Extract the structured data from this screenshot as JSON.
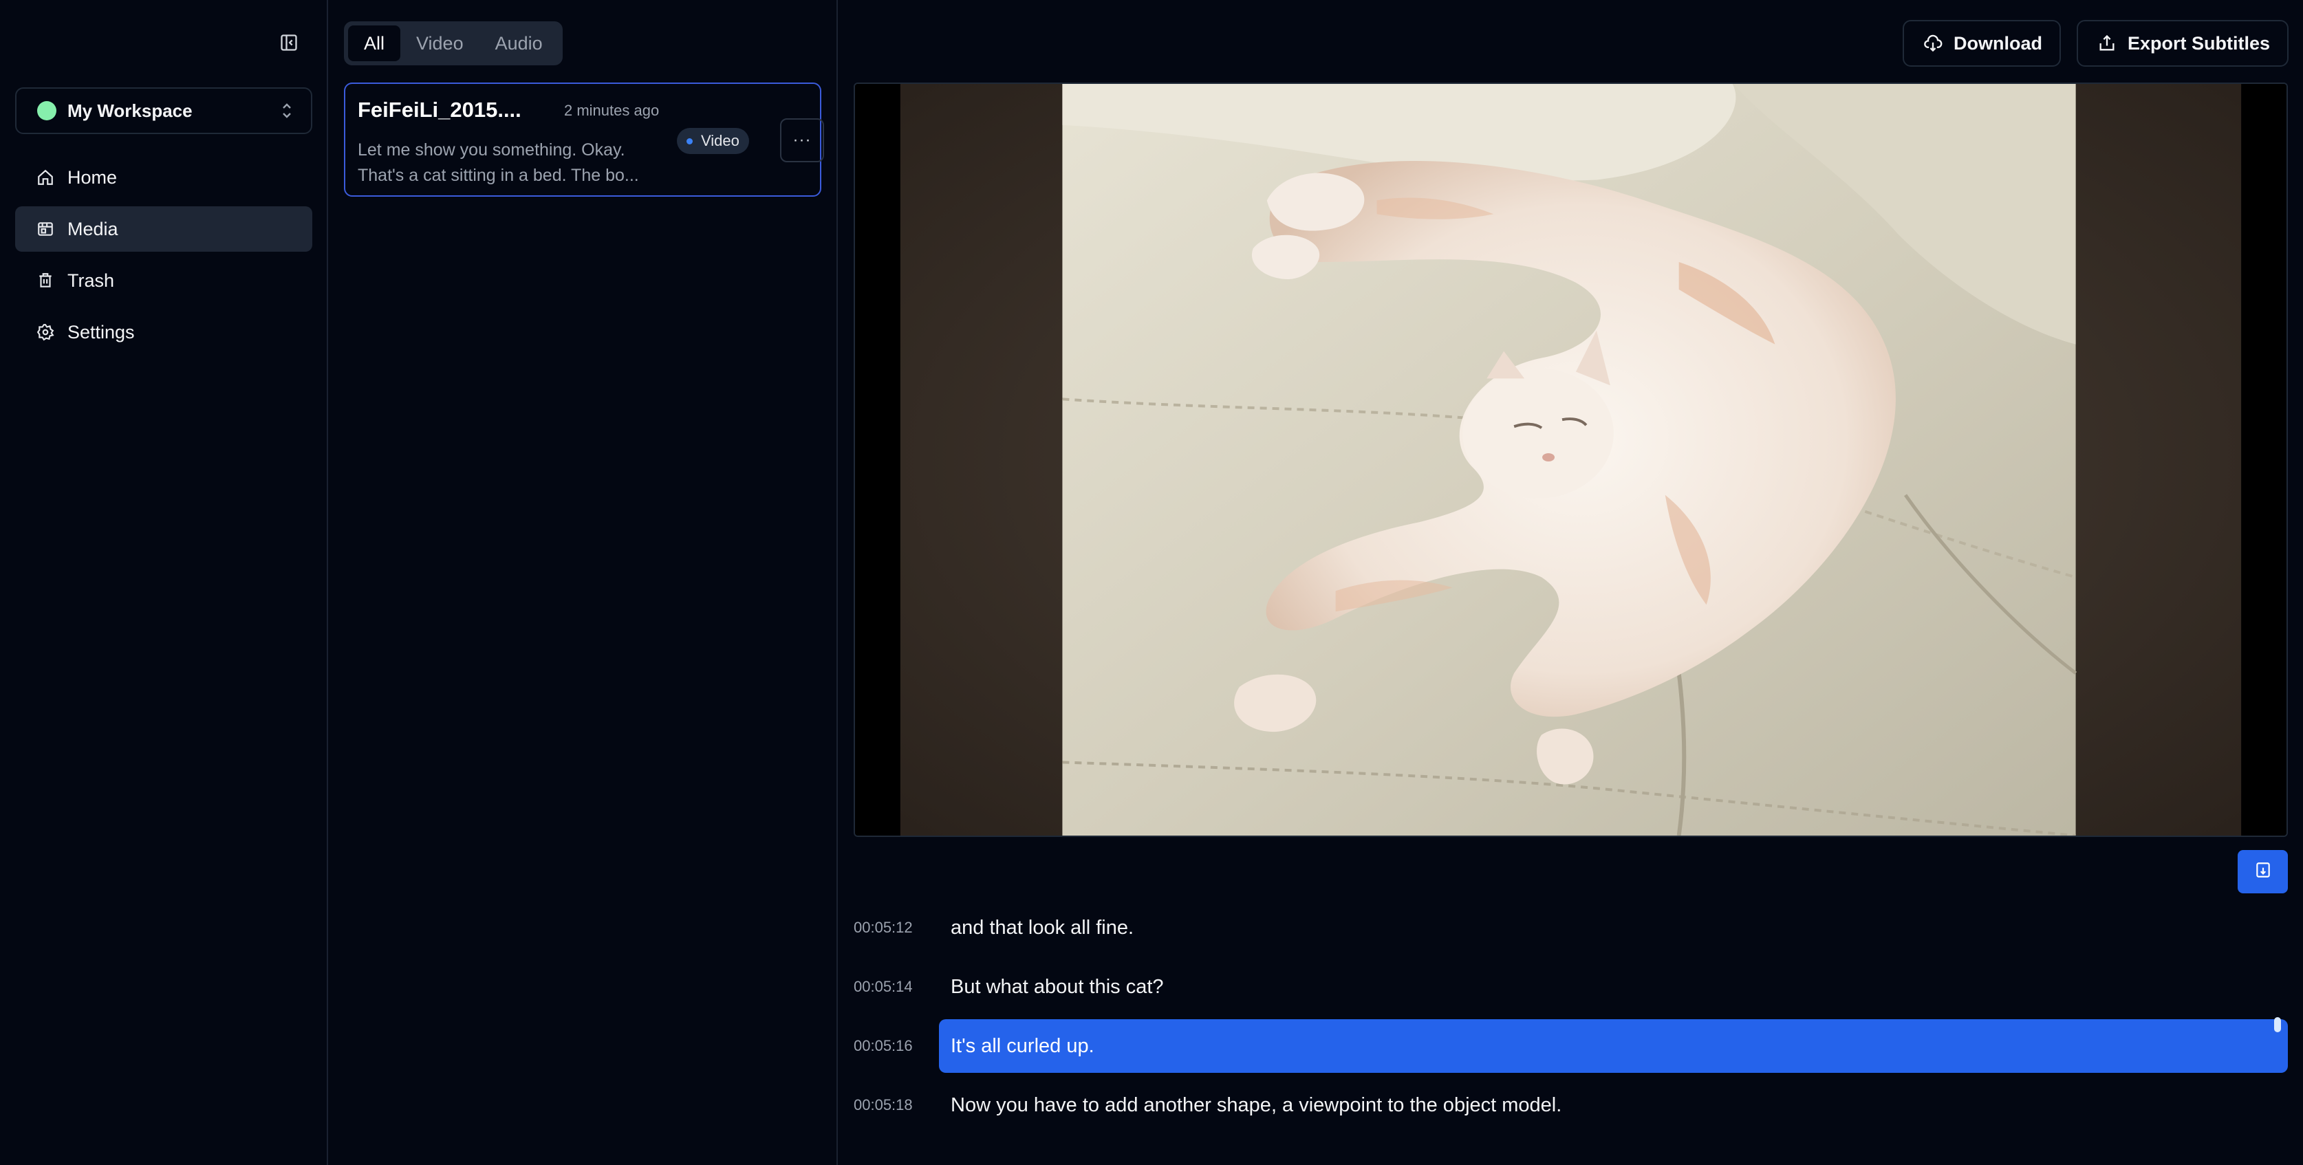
{
  "app": {
    "title": "Media"
  },
  "sidebar": {
    "collapse_icon": "sidebar-collapse-icon",
    "workspace": {
      "label": "My Workspace",
      "dot_color": "#86efac"
    },
    "items": [
      {
        "label": "Home",
        "icon": "home-icon",
        "active": false
      },
      {
        "label": "Media",
        "icon": "media-icon",
        "active": true
      },
      {
        "label": "Trash",
        "icon": "trash-icon",
        "active": false
      },
      {
        "label": "Settings",
        "icon": "gear-icon",
        "active": false
      }
    ]
  },
  "filters": {
    "tabs": [
      {
        "label": "All",
        "active": true
      },
      {
        "label": "Video",
        "active": false
      },
      {
        "label": "Audio",
        "active": false
      }
    ]
  },
  "media_list": {
    "items": [
      {
        "title": "FeiFeiLi_2015....",
        "time": "2 minutes ago",
        "snippet": "Let me show you something. Okay. That's a cat sitting in a bed. The bo...",
        "badge": "Video",
        "more_label": "···",
        "selected": true
      }
    ]
  },
  "header": {
    "download_label": "Download",
    "export_label": "Export Subtitles"
  },
  "player": {
    "alt": "Cat curled up on a cream leather sofa"
  },
  "follow_button": {
    "icon": "follow-playback-icon"
  },
  "transcript": {
    "segments": [
      {
        "time": "00:05:12",
        "text": "and that look all fine.",
        "active": false
      },
      {
        "time": "00:05:14",
        "text": "But what about this cat?",
        "active": false
      },
      {
        "time": "00:05:16",
        "text": "It's all curled up.",
        "active": true
      },
      {
        "time": "00:05:18",
        "text": "Now you have to add another shape, a viewpoint to the object model.",
        "active": false
      }
    ]
  },
  "colors": {
    "background": "#030712",
    "accent": "#2563eb",
    "active_nav": "#1e2635",
    "selected_border": "#3b5bdb"
  }
}
